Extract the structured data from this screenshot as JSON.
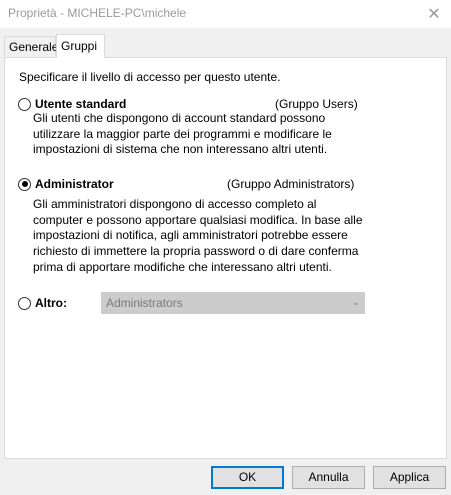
{
  "window": {
    "title": "Proprietà - MICHELE-PC\\michele",
    "close_icon": "close-icon"
  },
  "tabs": [
    {
      "label": "Generale",
      "active": false
    },
    {
      "label": "Gruppi",
      "active": true
    }
  ],
  "panel": {
    "intro": "Specificare il livello di accesso per questo utente.",
    "options": [
      {
        "label": "Utente standard",
        "group": "(Gruppo Users)",
        "checked": false,
        "description_lines": [
          "Gli utenti che dispongono di account standard possono",
          "utilizzare la maggior parte dei programmi e modificare le",
          "impostazioni di sistema che non interessano altri utenti."
        ]
      },
      {
        "label": "Administrator",
        "group": "(Gruppo Administrators)",
        "checked": true,
        "description_lines": [
          "Gli amministratori dispongono di accesso completo al",
          "computer e possono apportare qualsiasi modifica. In base alle",
          "impostazioni di notifica, agli amministratori potrebbe essere",
          "richiesto di immettere la propria password o di dare conferma",
          "prima di apportare modifiche che interessano altri utenti."
        ]
      },
      {
        "label": "Altro:",
        "checked": false,
        "select_value": "Administrators"
      }
    ]
  },
  "buttons": {
    "ok": "OK",
    "cancel": "Annulla",
    "apply": "Applica"
  }
}
